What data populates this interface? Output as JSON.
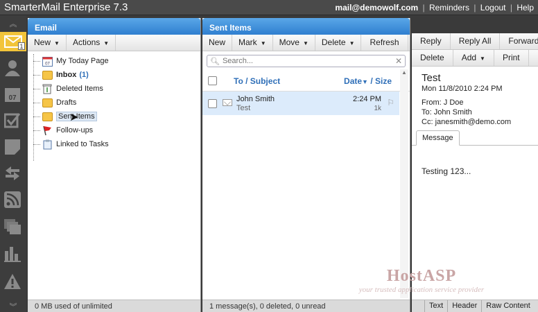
{
  "app": {
    "title": "SmarterMail Enterprise 7.3",
    "user_email": "mail@demowolf.com",
    "links": [
      "Reminders",
      "Logout",
      "Help"
    ]
  },
  "rail": {
    "mail_badge": "1",
    "icons": [
      "mail-icon",
      "contacts-icon",
      "calendar-icon",
      "tasks-icon",
      "notes-icon",
      "sync-icon",
      "rss-icon",
      "files-icon",
      "reports-icon",
      "alerts-icon"
    ]
  },
  "email_panel": {
    "title": "Email",
    "toolbar": {
      "new": "New",
      "actions": "Actions"
    },
    "folders": [
      {
        "label": "My Today Page"
      },
      {
        "label": "Inbox",
        "count": "(1)"
      },
      {
        "label": "Deleted Items"
      },
      {
        "label": "Drafts"
      },
      {
        "label": "Sent Items"
      },
      {
        "label": "Follow-ups"
      },
      {
        "label": "Linked to Tasks"
      }
    ],
    "footer": "0 MB used of unlimited"
  },
  "sent_panel": {
    "title": "Sent Items",
    "toolbar": {
      "new": "New",
      "mark": "Mark",
      "move": "Move",
      "delete": "Delete",
      "refresh": "Refresh"
    },
    "search_placeholder": "Search...",
    "columns": {
      "subject": "To / Subject",
      "date": "Date",
      "size": "/ Size"
    },
    "messages": [
      {
        "to": "John Smith",
        "subject": "Test",
        "time": "2:24 PM",
        "size": "1k"
      }
    ],
    "footer": "1 message(s), 0 deleted, 0 unread"
  },
  "reading_panel": {
    "toolbar_row1": {
      "reply": "Reply",
      "reply_all": "Reply All",
      "forward": "Forward"
    },
    "toolbar_row2": {
      "delete": "Delete",
      "add": "Add",
      "print": "Print"
    },
    "subject": "Test",
    "date": "Mon 11/8/2010 2:24 PM",
    "from_label": "From:",
    "from": "J Doe",
    "to_label": "To:",
    "to": "John Smith",
    "cc_label": "Cc:",
    "cc": "janesmith@demo.com",
    "tab": "Message",
    "body": "Testing 123...",
    "view_tabs": [
      "Text",
      "Header",
      "Raw Content"
    ]
  },
  "watermark": {
    "brand": "HostASP",
    "tagline": "your trusted application service provider"
  }
}
